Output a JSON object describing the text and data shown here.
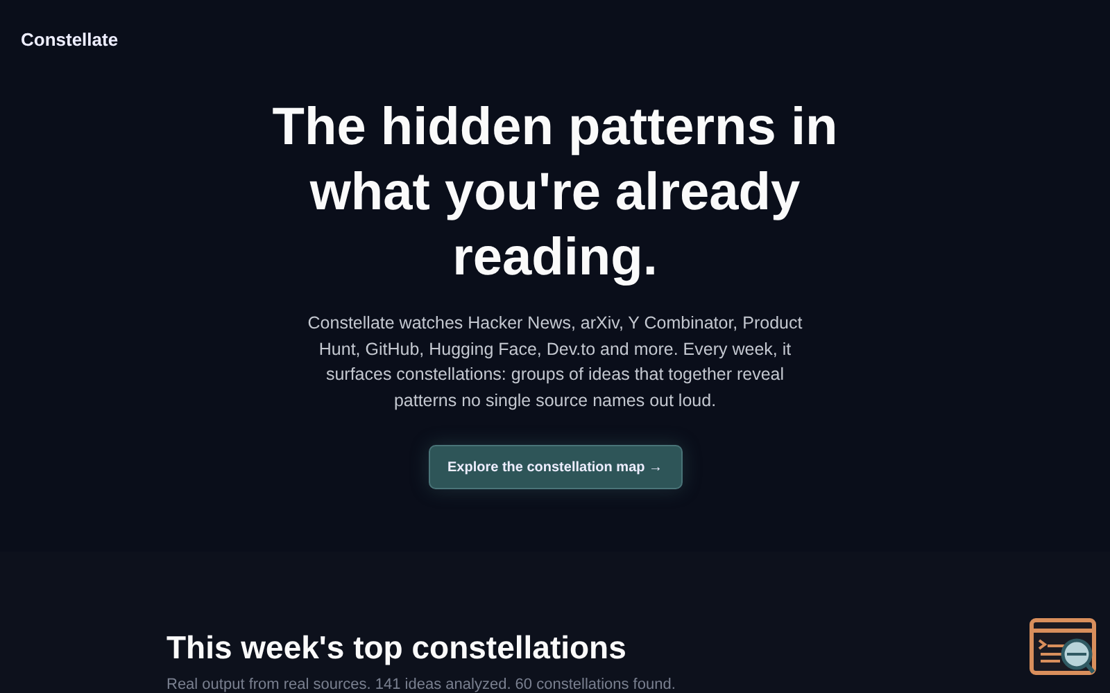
{
  "header": {
    "brand": "Constellate"
  },
  "hero": {
    "title": "The hidden patterns in what you're already reading.",
    "description": "Constellate watches Hacker News, arXiv, Y Combinator, Product Hunt, GitHub, Hugging Face, Dev.to and more. Every week, it surfaces constellations: groups of ideas that together reveal patterns no single source names out loud.",
    "cta": "Explore the constellation map →"
  },
  "section": {
    "title": "This week's top constellations",
    "subtitle": "Real output from real sources. 141 ideas analyzed. 60 constellations found."
  }
}
